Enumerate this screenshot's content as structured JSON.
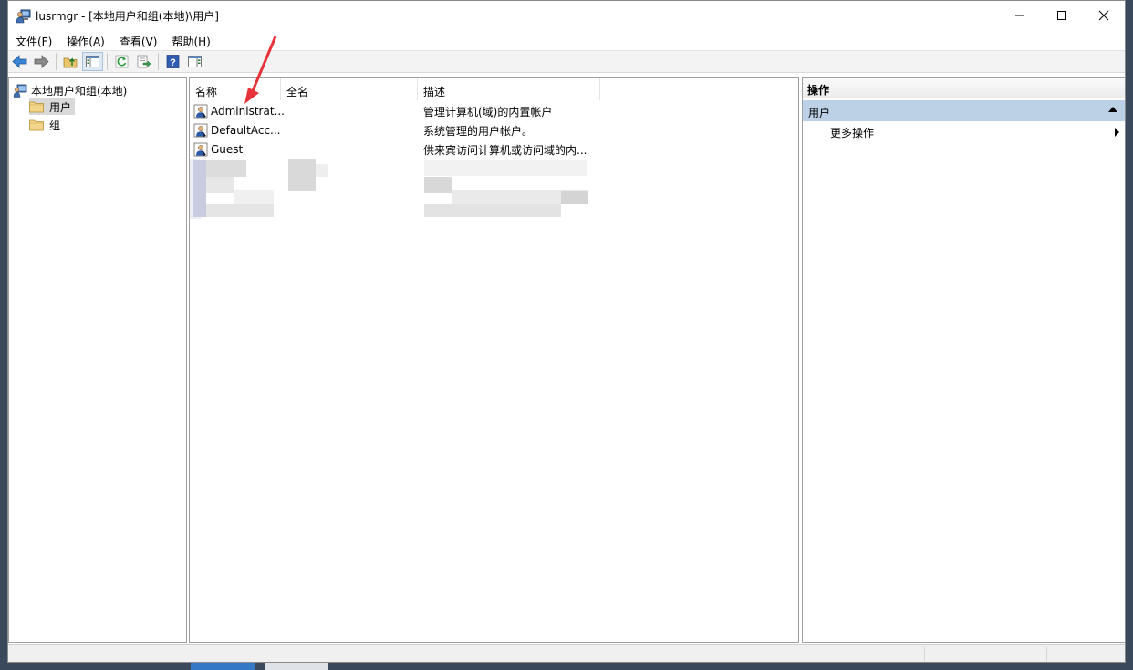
{
  "window": {
    "title": "lusrmgr - [本地用户和组(本地)\\用户]",
    "icon": "users-computer-icon"
  },
  "menu": {
    "items": [
      {
        "label": "文件(F)"
      },
      {
        "label": "操作(A)"
      },
      {
        "label": "查看(V)"
      },
      {
        "label": "帮助(H)"
      }
    ]
  },
  "toolbar": {
    "buttons": [
      "back-arrow-icon",
      "forward-arrow-icon",
      "up-folder-icon",
      "show-tree-icon",
      "refresh-icon",
      "export-list-icon",
      "help-icon",
      "action-pane-icon"
    ]
  },
  "tree": {
    "root": "本地用户和组(本地)",
    "nodes": [
      {
        "label": "用户",
        "selected": true
      },
      {
        "label": "组",
        "selected": false
      }
    ]
  },
  "list": {
    "columns": [
      "名称",
      "全名",
      "描述"
    ],
    "rows": [
      {
        "name": "Administrat...",
        "fullname": "",
        "description": "管理计算机(域)的内置帐户"
      },
      {
        "name": "DefaultAcc...",
        "fullname": "",
        "description": "系统管理的用户帐户。"
      },
      {
        "name": "Guest",
        "fullname": "",
        "description": "供来宾访问计算机或访问域的内..."
      }
    ]
  },
  "actions": {
    "title": "操作",
    "section": "用户",
    "items": [
      "更多操作"
    ]
  },
  "colors": {
    "selection": "#d9d9d9",
    "action_section": "#bcd0e6",
    "annotation_arrow": "#e8323a"
  }
}
